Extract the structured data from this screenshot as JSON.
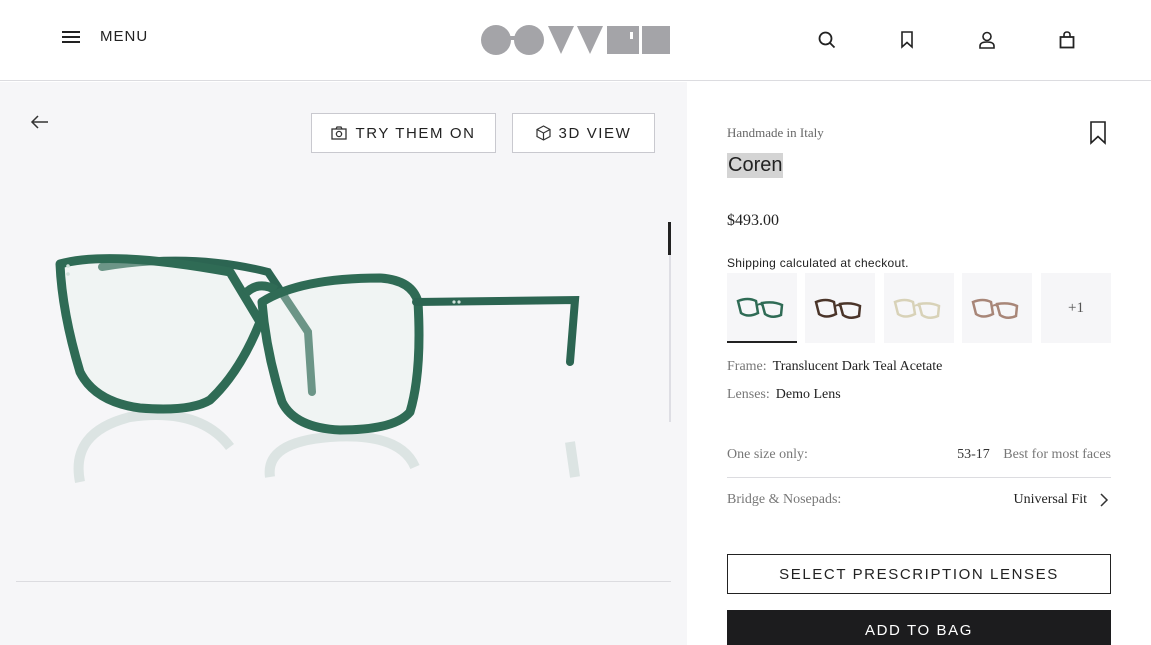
{
  "header": {
    "menu_label": "MENU",
    "logo_name": "brand-logo",
    "icons": [
      "search-icon",
      "bookmark-icon",
      "account-icon",
      "bag-icon"
    ]
  },
  "gallery": {
    "try_on_label": "TRY THEM ON",
    "view_3d_label": "3D VIEW"
  },
  "product": {
    "origin": "Handmade in Italy",
    "name": "Coren",
    "price": "$493.00",
    "shipping_note": "Shipping calculated at checkout.",
    "swatches": [
      {
        "color": "#2f6b55"
      },
      {
        "color": "#4a3429"
      },
      {
        "color": "#d8d2b8"
      },
      {
        "color": "#a88678"
      }
    ],
    "more_swatches": "+1",
    "frame_label": "Frame:",
    "frame_value": "Translucent Dark Teal Acetate",
    "lenses_label": "Lenses:",
    "lenses_value": "Demo Lens",
    "size_label": "One size only:",
    "size_value": "53-17",
    "size_note": "Best for most faces",
    "bridge_label": "Bridge & Nosepads:",
    "bridge_value": "Universal Fit",
    "prescription_label": "SELECT PRESCRIPTION LENSES",
    "add_to_bag_label": "ADD TO BAG"
  },
  "colors": {
    "accent_dark": "#1c1c1e",
    "frame_green": "#2f6b55",
    "gallery_bg": "#f6f6f8"
  }
}
